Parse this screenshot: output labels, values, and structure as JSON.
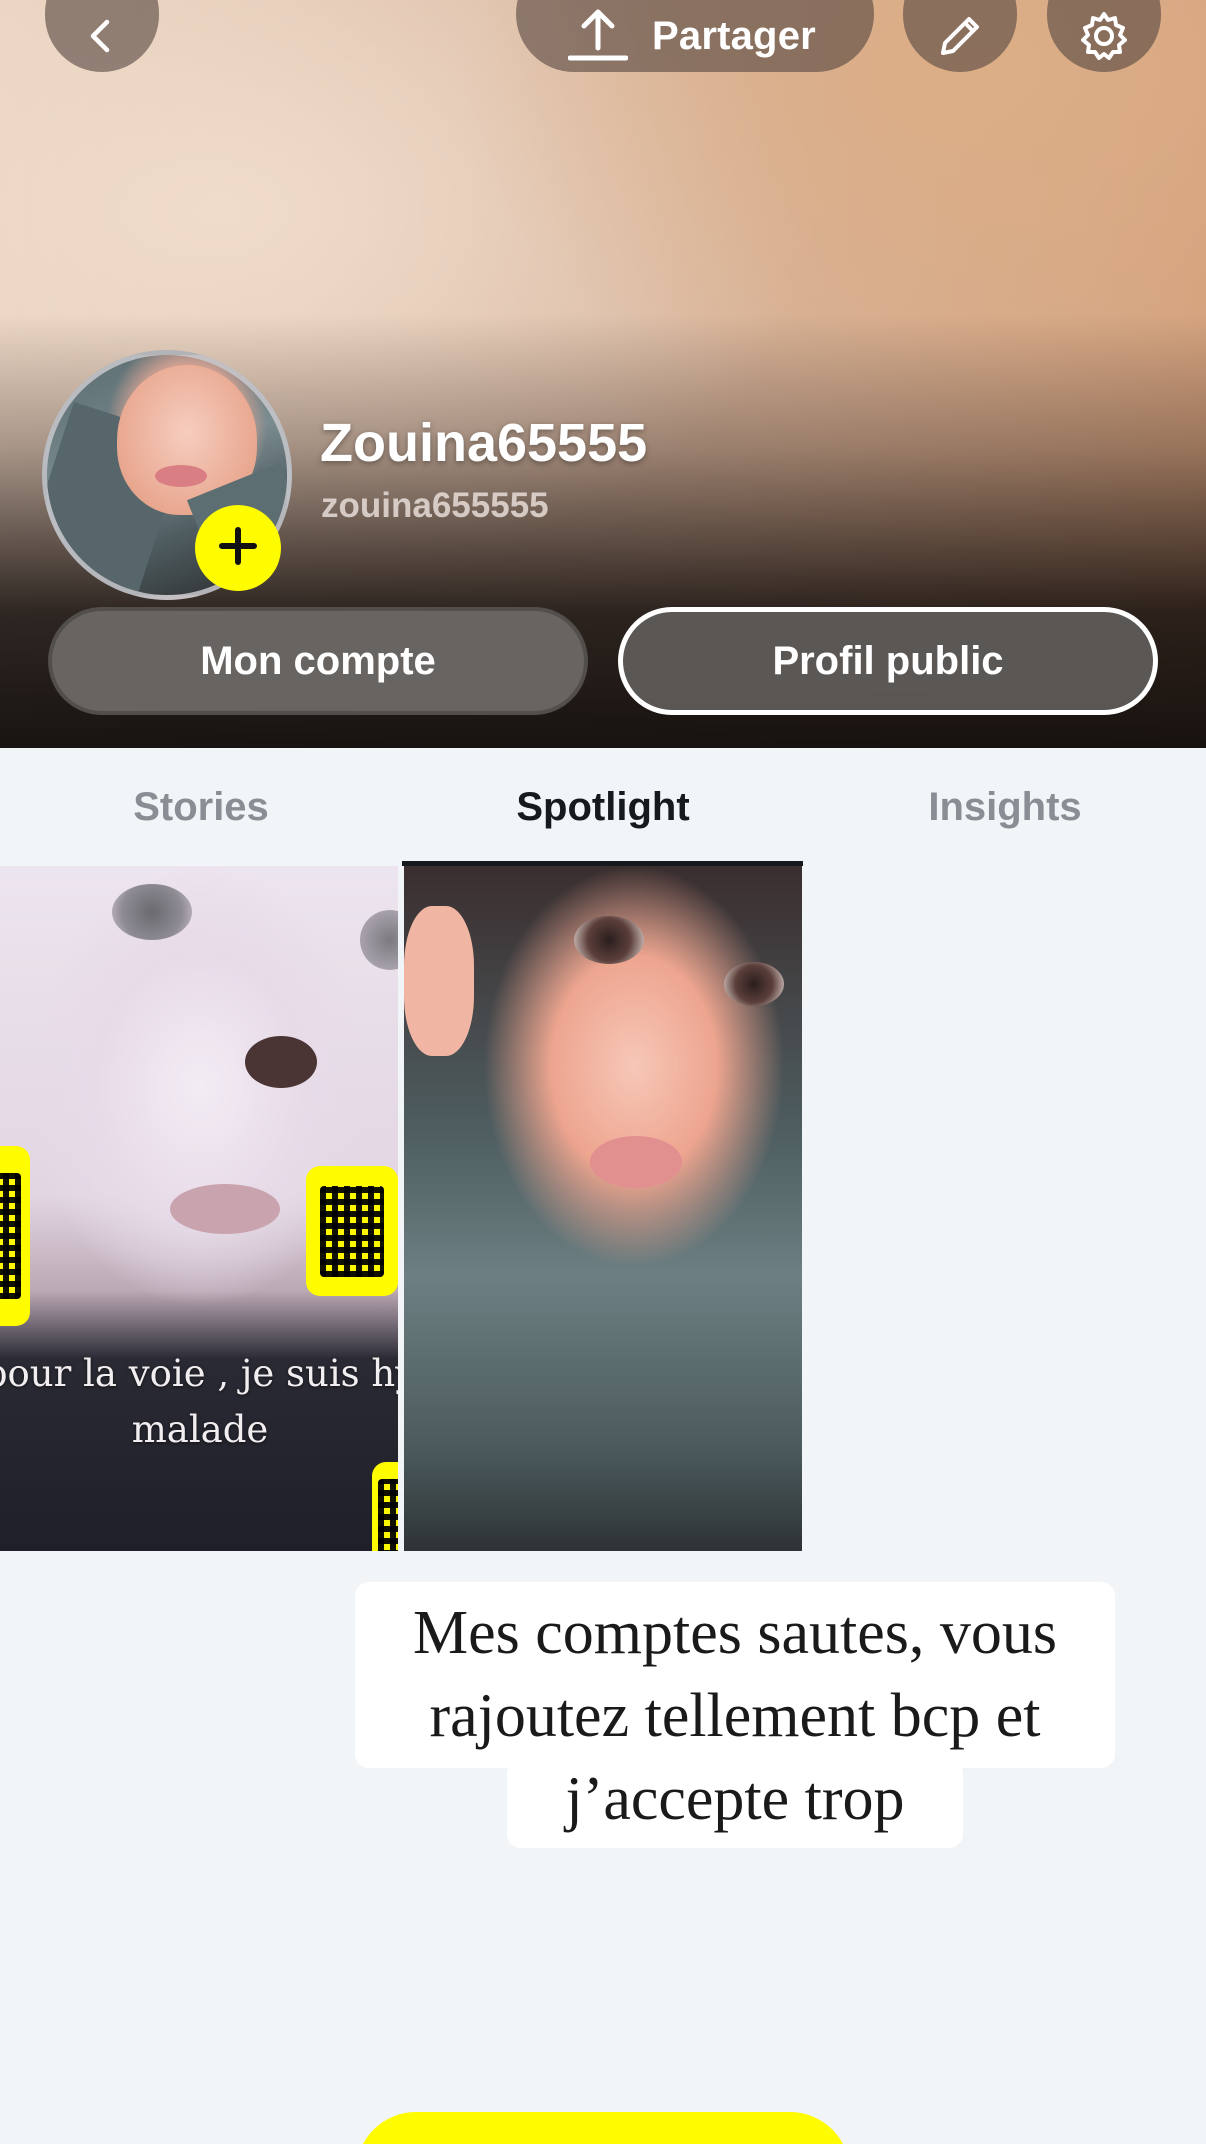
{
  "header": {
    "share_label": "Partager",
    "display_name": "Zouina65555",
    "username": "zouina655555",
    "account_button": "Mon compte",
    "public_profile_button": "Profil public",
    "icons": [
      "back-icon",
      "share-icon",
      "edit-icon",
      "settings-icon",
      "add-icon"
    ]
  },
  "tabs": [
    {
      "label": "Stories",
      "active": false
    },
    {
      "label": "Spotlight",
      "active": true
    },
    {
      "label": "Insights",
      "active": false
    }
  ],
  "spotlight": {
    "tiles": [
      {
        "caption": "pour la voie , je suis hy\nmalade"
      },
      {
        "caption": ""
      }
    ]
  },
  "story_caption": "Mes comptes sautes, vous rajoutez tellement bcp et j’accepte trop",
  "colors": {
    "snap_yellow": "#fffc00",
    "active_tab": "#16191d",
    "inactive_tab": "#8a8e94",
    "background": "#f2f5f8"
  }
}
